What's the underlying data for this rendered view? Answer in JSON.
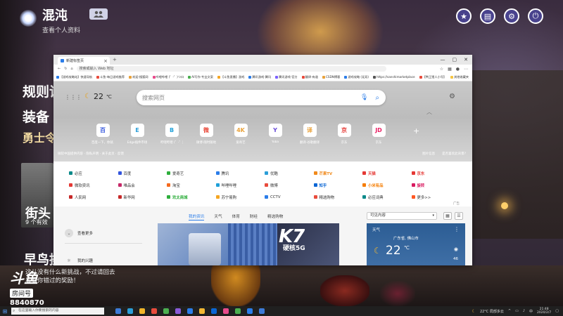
{
  "profile": {
    "name": "混沌",
    "subtitle": "查看个人资料"
  },
  "top_right_icons": [
    "star-icon",
    "document-icon",
    "gear-icon",
    "power-icon"
  ],
  "game_text": {
    "line1": "规则说",
    "line2": "装备",
    "line3": "勇士令",
    "card_title": "街头",
    "card_sub": "9 个有效",
    "bottom_title": "早鸟挑战",
    "bottom_sub1": "这儿没有什么新挑战，不过请回去",
    "bottom_sub2": "看看你错过的奖励！"
  },
  "douyu": {
    "logo": "斗鱼",
    "room_label": "房间号",
    "room_number": "8840870"
  },
  "browser": {
    "tab_title": "新建标签页",
    "address": "搜索或输入 Web 地址",
    "favorites": [
      {
        "label": "【游戏攻略站】快速导航",
        "color": "#2b7de9"
      },
      {
        "label": "斗鱼-每日游戏推荐",
        "color": "#e94b3c"
      },
      {
        "label": "欢迎-搜狐网",
        "color": "#e9a23b"
      },
      {
        "label": "哔哩哔哩 (゜-゜)つロ",
        "color": "#e94b8c"
      },
      {
        "label": "AI写作-专业文案",
        "color": "#4caf50"
      },
      {
        "label": "【斗鱼直播】游戏",
        "color": "#f5a623"
      },
      {
        "label": "腾讯游戏-腾讯",
        "color": "#2b7de9"
      },
      {
        "label": "腾讯游戏-官方",
        "color": "#7b61ff"
      },
      {
        "label": "翻译-有道",
        "color": "#e94b3c"
      },
      {
        "label": "CSDN博客",
        "color": "#e9a23b"
      },
      {
        "label": "游戏攻略 (无双)",
        "color": "#2b7de9"
      },
      {
        "label": "https://sanshimarketplace",
        "color": "#555555"
      },
      {
        "label": "【鸭王猎人小号】",
        "color": "#e94b3c"
      },
      {
        "label": "其他收藏夹",
        "color": "#f5c542"
      }
    ],
    "newtab": {
      "weather_temp": "22",
      "weather_unit": "℃",
      "search_placeholder": "搜索网页",
      "quicklinks": [
        {
          "label": "百度一下，你就...",
          "glyph": "百",
          "color": "#3355dd"
        },
        {
          "label": "Edge插件市场",
          "glyph": "E",
          "color": "#2b9ed8"
        },
        {
          "label": "哔哩哔哩 (゜-゜)",
          "glyph": "B",
          "color": "#1fa0d8"
        },
        {
          "label": "微博-随时随地",
          "glyph": "微",
          "color": "#e94b3c"
        },
        {
          "label": "爱奇艺",
          "glyph": "4K",
          "color": "#e9a23b"
        },
        {
          "label": "Yoba",
          "glyph": "Y",
          "color": "#6a4cd8"
        },
        {
          "label": "翻译-谷歌翻译",
          "glyph": "译",
          "color": "#e9a23b"
        },
        {
          "label": "京东",
          "glyph": "京",
          "color": "#e53935"
        },
        {
          "label": "京东",
          "glyph": "JD",
          "color": "#e91e63"
        }
      ],
      "footer_left": "微软中国提供内容 · 隐私声明 · 关于此页 · 反馈",
      "footer_right1": "图片信息",
      "footer_right2": "是否喜欢此背景?"
    },
    "links": [
      [
        {
          "label": "必应",
          "color": "#0a8a8a"
        },
        {
          "label": "百度",
          "color": "#3355dd"
        },
        {
          "label": "爱奇艺",
          "color": "#2eae3c"
        },
        {
          "label": "腾讯",
          "color": "#2b7de9"
        },
        {
          "label": "优酷",
          "color": "#2b9ed8"
        },
        {
          "label": "芒果TV",
          "color": "#f08a1c"
        },
        {
          "label": "天猫",
          "color": "#e53935"
        },
        {
          "label": "京东",
          "color": "#e53935"
        }
      ],
      [
        {
          "label": "微软资讯",
          "color": "#e53935"
        },
        {
          "label": "唯品会",
          "color": "#c62868"
        },
        {
          "label": "淘宝",
          "color": "#f56a1e"
        },
        {
          "label": "哔哩哔哩",
          "color": "#1fa0d8"
        },
        {
          "label": "微博",
          "color": "#e94b3c"
        },
        {
          "label": "知乎",
          "color": "#0a66d4"
        },
        {
          "label": "小米有品",
          "color": "#f57c00"
        },
        {
          "label": "旋转",
          "color": "#d81b60"
        }
      ],
      [
        {
          "label": "人民网",
          "color": "#c62828"
        },
        {
          "label": "新华网",
          "color": "#c62828"
        },
        {
          "label": "欢太商城",
          "color": "#2eae3c"
        },
        {
          "label": "苏宁易购",
          "color": "#f5a623"
        },
        {
          "label": "CCTV",
          "color": "#2b7de9"
        },
        {
          "label": "精选购物",
          "color": "#e94b3c"
        },
        {
          "label": "必应词典",
          "color": "#0a8a8a"
        },
        {
          "label": "更多>>",
          "color": "#ff5722"
        }
      ]
    ],
    "links_ad": "广告",
    "feed": {
      "side_items": [
        "查看更多",
        "我的兴趣"
      ],
      "tabs": [
        "我的资讯",
        "天气",
        "体育",
        "财经",
        "精选购物"
      ],
      "active_tab": "我的资讯",
      "select_label": "可见内容",
      "card_brand": "K7",
      "card_sub": "硬核5G",
      "weather": {
        "title": "天气",
        "location": "广东省, 佛山市",
        "temp": "22",
        "unit": "℃",
        "aqi": "46"
      }
    }
  },
  "taskbar": {
    "search_placeholder": "在这里输入你要搜索的内容",
    "apps": [
      "#3d7bd8",
      "#2b9ed8",
      "#f0b429",
      "#e94b3c",
      "#4caf50",
      "#8a5bd8",
      "#2b7de9",
      "#f2b632",
      "#0a66d4",
      "#e94b8c",
      "#4caf50",
      "#2b7de9",
      "#3d7bd8"
    ],
    "weather_tray": "22°C  局部多云",
    "time": "21:48",
    "date": "2020/2/7"
  }
}
